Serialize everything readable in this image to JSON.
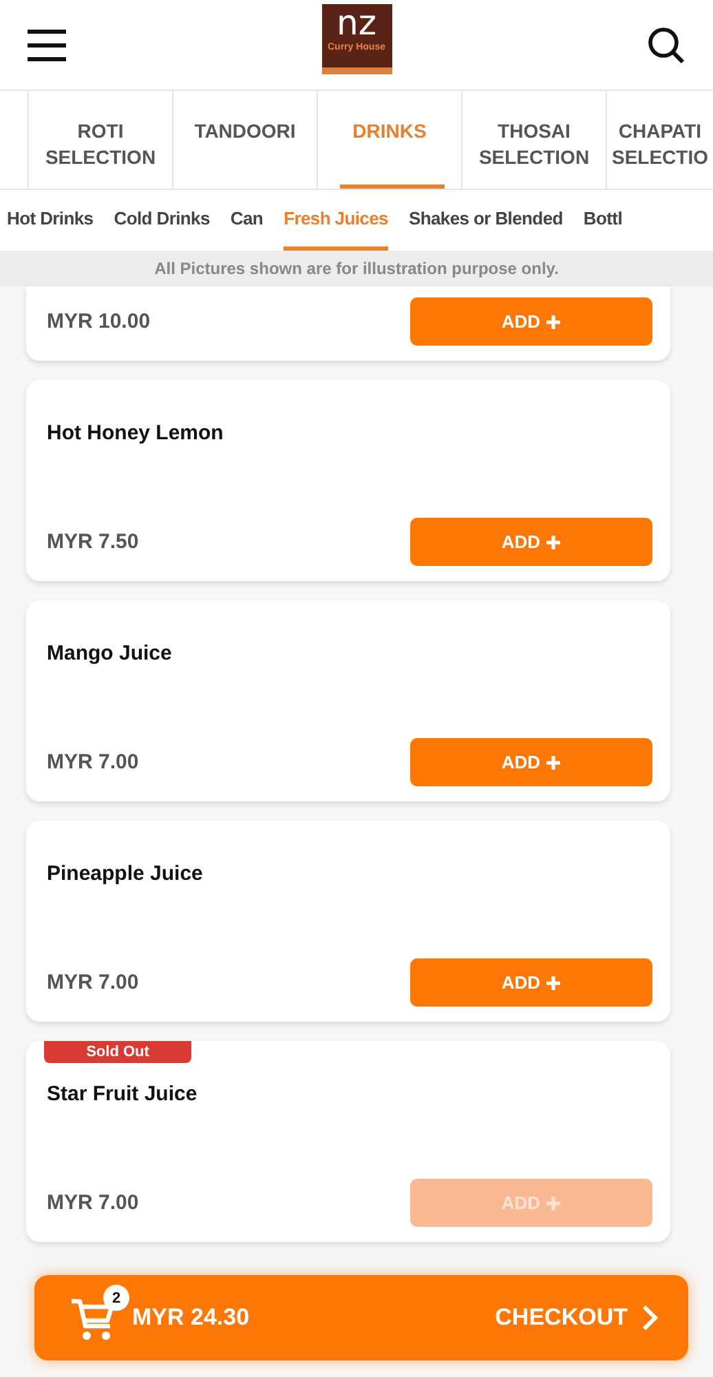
{
  "header": {
    "logo": {
      "mark": "nz",
      "subtitle": "Curry House"
    }
  },
  "categories": [
    {
      "label": "ROTI SELECTION",
      "selected": false
    },
    {
      "label": "TANDOORI",
      "selected": false
    },
    {
      "label": "DRINKS",
      "selected": true
    },
    {
      "label": "THOSAI SELECTION",
      "selected": false
    },
    {
      "label": "CHAPATI SELECTIO",
      "selected": false
    }
  ],
  "subcategories": [
    {
      "label": "Hot Drinks",
      "selected": false
    },
    {
      "label": "Cold Drinks",
      "selected": false
    },
    {
      "label": "Can",
      "selected": false
    },
    {
      "label": "Fresh Juices",
      "selected": true
    },
    {
      "label": "Shakes or Blended",
      "selected": false
    },
    {
      "label": "Bottl",
      "selected": false
    }
  ],
  "notice": "All Pictures shown are for illustration purpose only.",
  "items": [
    {
      "price": "MYR 10.00",
      "button": "ADD",
      "sold_out": false
    },
    {
      "name": "Hot Honey Lemon",
      "price": "MYR 7.50",
      "button": "ADD",
      "sold_out": false
    },
    {
      "name": "Mango Juice",
      "price": "MYR 7.00",
      "button": "ADD",
      "sold_out": false
    },
    {
      "name": "Pineapple Juice",
      "price": "MYR 7.00",
      "button": "ADD",
      "sold_out": false
    },
    {
      "name": "Star Fruit Juice",
      "badge": "Sold Out",
      "price": "MYR 7.00",
      "button": "ADD",
      "sold_out": true
    }
  ],
  "cart": {
    "count": "2",
    "total": "MYR 24.30",
    "checkout": "CHECKOUT"
  }
}
